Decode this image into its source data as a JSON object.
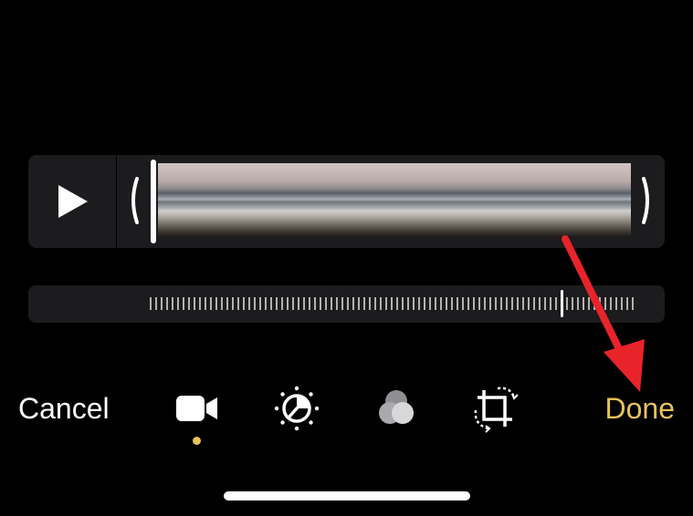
{
  "toolbar": {
    "cancel_label": "Cancel",
    "done_label": "Done",
    "tools": [
      {
        "icon": "video-camera-icon",
        "active": true
      },
      {
        "icon": "adjust-dial-icon",
        "active": false
      },
      {
        "icon": "filters-icon",
        "active": false
      },
      {
        "icon": "crop-rotate-icon",
        "active": false
      }
    ]
  },
  "trimmer": {
    "play_icon": "play-icon",
    "frame_count": 4,
    "left_handle_icon": "chevron-left-icon",
    "right_handle_icon": "chevron-right-icon"
  },
  "slider": {
    "knob_position": 0.85
  },
  "colors": {
    "accent": "#e8c25a",
    "background": "#000000",
    "panel": "#1c1c1e",
    "annotation": "#e8242a"
  }
}
